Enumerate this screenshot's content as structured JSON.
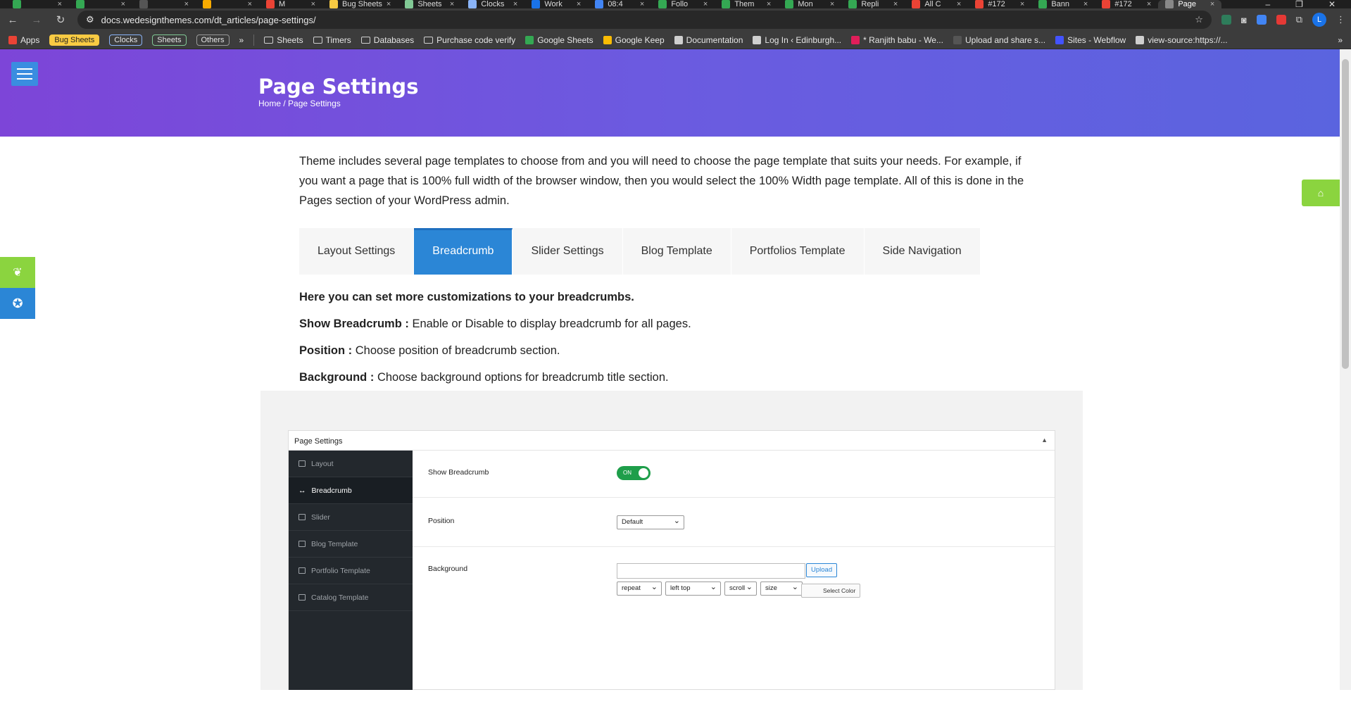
{
  "browser": {
    "tabs": [
      {
        "label": "",
        "color": "#34a853"
      },
      {
        "label": "",
        "color": "#34a853"
      },
      {
        "label": "",
        "color": "#555"
      },
      {
        "label": "",
        "color": "#f9ab00"
      },
      {
        "label": "M",
        "color": "#ea4335"
      },
      {
        "label": "Bug Sheets",
        "color": "#f9cb43"
      },
      {
        "label": "Sheets",
        "color": "#81c995"
      },
      {
        "label": "Clocks",
        "color": "#8ab4f8"
      },
      {
        "label": "Work",
        "color": "#1a73e8"
      },
      {
        "label": "08:4",
        "color": "#4285f4"
      },
      {
        "label": "Follo",
        "color": "#34a853"
      },
      {
        "label": "Them",
        "color": "#34a853"
      },
      {
        "label": "Mon",
        "color": "#34a853"
      },
      {
        "label": "Repli",
        "color": "#34a853"
      },
      {
        "label": "All C",
        "color": "#ea4335"
      },
      {
        "label": "#172",
        "color": "#ea4335"
      },
      {
        "label": "Bann",
        "color": "#34a853"
      },
      {
        "label": "#172",
        "color": "#ea4335"
      },
      {
        "label": "Page",
        "color": "#888",
        "active": true
      }
    ],
    "url": "docs.wedesignthemes.com/dt_articles/page-settings/",
    "bookmarks": {
      "apps": "Apps",
      "chips": [
        "Bug Sheets",
        "Clocks",
        "Sheets",
        "Others"
      ],
      "more": "»",
      "items": [
        "Sheets",
        "Timers",
        "Databases",
        "Purchase code verify",
        "Google Sheets",
        "Google Keep",
        "Documentation",
        "Log In ‹ Edinburgh...",
        "* Ranjith babu - We...",
        "Upload and share s...",
        "Sites - Webflow",
        "view-source:https://..."
      ]
    },
    "profile_initial": "L"
  },
  "hero": {
    "title": "Page Settings",
    "breadcrumb_home": "Home",
    "breadcrumb_sep": "/",
    "breadcrumb_current": "Page Settings"
  },
  "intro": "Theme includes several page templates to choose from and you will need to choose the page template that suits your needs. For example, if you want a page that is 100% full width of the browser window, then you would select the 100% Width page template. All of this is done in the Pages section of your WordPress admin.",
  "tabs": [
    "Layout Settings",
    "Breadcrumb",
    "Slider Settings",
    "Blog Template",
    "Portfolios Template",
    "Side Navigation"
  ],
  "active_tab": "Breadcrumb",
  "desc": {
    "heading": "Here you can set more customizations to your breadcrumbs.",
    "show_label": "Show Breadcrumb :",
    "show_text": "Enable or Disable to display breadcrumb for all pages.",
    "position_label": "Position :",
    "position_text": "Choose position of breadcrumb section.",
    "background_label": "Background :",
    "background_text": "Choose background options for breadcrumb title section."
  },
  "screenshot": {
    "panel_title": "Page Settings",
    "sidebar": [
      "Layout",
      "Breadcrumb",
      "Slider",
      "Blog Template",
      "Portfolio Template",
      "Catalog Template"
    ],
    "show_breadcrumb_label": "Show Breadcrumb",
    "toggle_text": "ON",
    "position_label": "Position",
    "position_value": "Default",
    "background_label": "Background",
    "upload_label": "Upload",
    "repeat_value": "repeat",
    "position2_value": "left top",
    "attach_value": "scroll",
    "size_value": "size",
    "select_color_label": "Select Color"
  },
  "colors": {
    "hero_start": "#7d45d8",
    "hero_end": "#5a64df",
    "accent_blue": "#2b86d6",
    "accent_green": "#8bd43f"
  }
}
